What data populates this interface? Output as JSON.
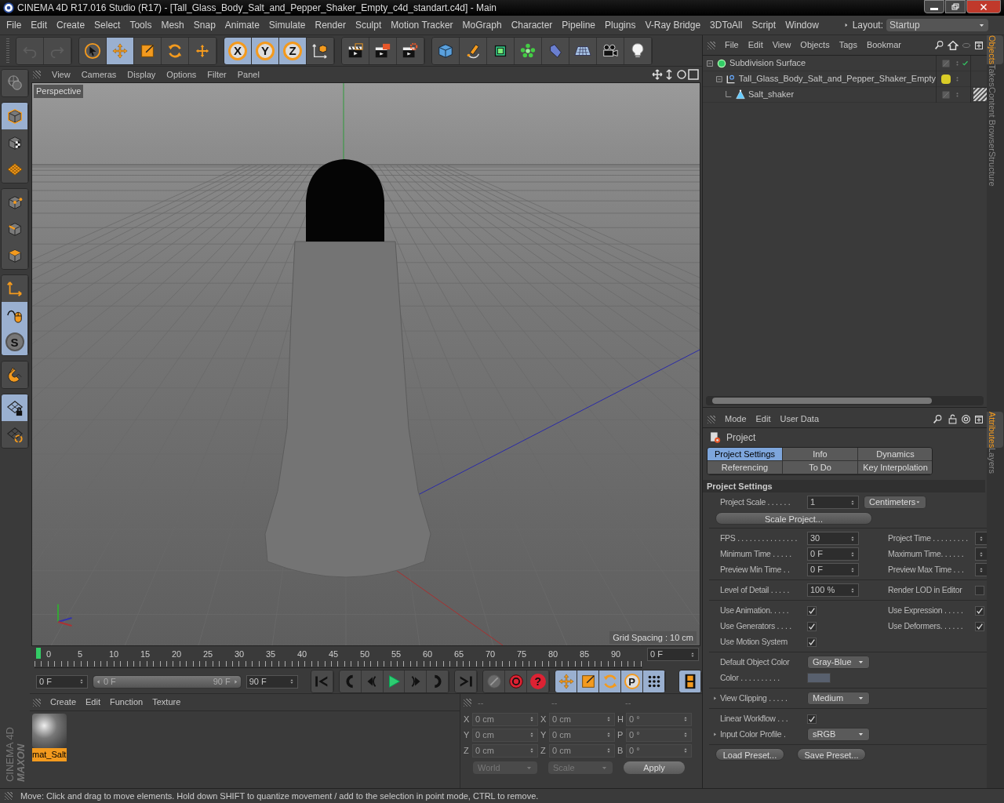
{
  "window": {
    "title": "CINEMA 4D R17.016 Studio (R17) - [Tall_Glass_Body_Salt_and_Pepper_Shaker_Empty_c4d_standart.c4d] - Main"
  },
  "menu": [
    "File",
    "Edit",
    "Create",
    "Select",
    "Tools",
    "Mesh",
    "Snap",
    "Animate",
    "Simulate",
    "Render",
    "Sculpt",
    "Motion Tracker",
    "MoGraph",
    "Character",
    "Pipeline",
    "Plugins",
    "V-Ray Bridge",
    "3DToAll",
    "Script",
    "Window"
  ],
  "layout": {
    "label": "Layout:",
    "value": "Startup"
  },
  "toolbar": [
    [
      {
        "kind": "undo",
        "selected": false
      },
      {
        "kind": "redo",
        "selected": false
      }
    ],
    [
      {
        "kind": "select",
        "selected": false
      },
      {
        "kind": "move",
        "selected": true
      },
      {
        "kind": "scale",
        "selected": false
      },
      {
        "kind": "rotate",
        "selected": false
      },
      {
        "kind": "transform",
        "selected": false
      }
    ],
    [
      {
        "kind": "axis",
        "label": "X",
        "selected": true
      },
      {
        "kind": "axis",
        "label": "Y",
        "selected": true
      },
      {
        "kind": "axis",
        "label": "Z",
        "selected": true
      },
      {
        "kind": "coords",
        "selected": false
      }
    ],
    [
      {
        "kind": "render-view",
        "selected": false
      },
      {
        "kind": "render-picture",
        "selected": false
      },
      {
        "kind": "render-settings",
        "selected": false
      }
    ],
    [
      {
        "kind": "cube",
        "selected": false
      },
      {
        "kind": "pen",
        "selected": false
      },
      {
        "kind": "subdivision",
        "selected": false
      },
      {
        "kind": "cloner",
        "selected": false
      },
      {
        "kind": "deformer",
        "selected": false
      },
      {
        "kind": "floor",
        "selected": false
      },
      {
        "kind": "camera",
        "selected": false
      },
      {
        "kind": "light",
        "selected": false
      }
    ]
  ],
  "left_tools": [
    [
      {
        "kind": "globe",
        "selected": false
      }
    ],
    [
      {
        "kind": "model",
        "selected": true
      },
      {
        "kind": "texture",
        "selected": false
      },
      {
        "kind": "workplane",
        "selected": false
      }
    ],
    [
      {
        "kind": "points",
        "selected": false
      },
      {
        "kind": "edges",
        "selected": false
      },
      {
        "kind": "polygons",
        "selected": false
      }
    ],
    [
      {
        "kind": "axis-mode",
        "selected": false
      },
      {
        "kind": "tweak",
        "selected": true
      },
      {
        "kind": "snap",
        "label": "S",
        "selected": true
      }
    ],
    [
      {
        "kind": "magnet",
        "selected": false
      }
    ],
    [
      {
        "kind": "grid-lock",
        "selected": true
      },
      {
        "kind": "grid-sync",
        "selected": false
      }
    ]
  ],
  "viewport": {
    "menu": [
      "View",
      "Cameras",
      "Display",
      "Options",
      "Filter",
      "Panel"
    ],
    "camera": "Perspective",
    "grid_spacing": "Grid Spacing : 10 cm"
  },
  "timeline": {
    "ticks": [
      "0",
      "5",
      "10",
      "15",
      "20",
      "25",
      "30",
      "35",
      "40",
      "45",
      "50",
      "55",
      "60",
      "65",
      "70",
      "75",
      "80",
      "85",
      "90"
    ],
    "current": "0 F"
  },
  "transport": {
    "start": "0 F",
    "range": {
      "start": "0 F",
      "end": "90 F",
      "level": 1
    },
    "end": "90 F",
    "buttons": [
      [
        {
          "kind": "first"
        }
      ],
      [
        {
          "kind": "prev-key"
        },
        {
          "kind": "prev-frame"
        },
        {
          "kind": "play"
        },
        {
          "kind": "next-frame"
        },
        {
          "kind": "next-key"
        }
      ],
      [
        {
          "kind": "last"
        }
      ],
      [
        {
          "kind": "record"
        },
        {
          "kind": "autokey"
        },
        {
          "kind": "help",
          "label": "?"
        }
      ],
      [
        {
          "kind": "move",
          "selected": true
        },
        {
          "kind": "scale",
          "selected": true
        },
        {
          "kind": "rotate",
          "selected": true
        },
        {
          "kind": "param",
          "label": "P",
          "selected": true
        },
        {
          "kind": "dots",
          "selected": true
        }
      ],
      [
        {
          "kind": "film",
          "selected": true
        }
      ]
    ]
  },
  "materials": {
    "menu": [
      "Create",
      "Edit",
      "Function",
      "Texture"
    ],
    "items": [
      {
        "name": "mat_Salt",
        "selected": true
      }
    ]
  },
  "coordinates": {
    "headers": [
      "--",
      "--",
      "--"
    ],
    "rows": [
      {
        "pos_axis": "X",
        "pos": "0 cm",
        "size_axis": "X",
        "size": "0 cm",
        "rot_axis": "H",
        "rot": "0 °"
      },
      {
        "pos_axis": "Y",
        "pos": "0 cm",
        "size_axis": "Y",
        "size": "0 cm",
        "rot_axis": "P",
        "rot": "0 °"
      },
      {
        "pos_axis": "Z",
        "pos": "0 cm",
        "size_axis": "Z",
        "size": "0 cm",
        "rot_axis": "B",
        "rot": "0 °"
      }
    ],
    "mode": "World",
    "measure": "Scale",
    "apply": "Apply"
  },
  "logo": {
    "brand": "MAXON",
    "product": "CINEMA 4D"
  },
  "status_bar": "Move: Click and drag to move elements. Hold down SHIFT to quantize movement / add to the selection in point mode, CTRL to remove.",
  "objects": {
    "menu": [
      "File",
      "Edit",
      "View",
      "Objects",
      "Tags",
      "Bookmar"
    ],
    "tree": [
      {
        "name": "Subdivision Surface",
        "kind": "subdivision",
        "checked": true,
        "children": [
          {
            "name": "Tall_Glass_Body_Salt_and_Pepper_Shaker_Empty",
            "kind": "null",
            "checked": false,
            "color": "#d9cc27",
            "children": [
              {
                "name": "Salt_shaker",
                "kind": "polygon",
                "checked": false,
                "material_tag": true
              }
            ]
          }
        ]
      }
    ]
  },
  "side_tabs_top": [
    {
      "label": "Objects",
      "selected": true
    },
    {
      "label": "Takes",
      "selected": false
    },
    {
      "label": "Content Browser",
      "selected": false
    },
    {
      "label": "Structure",
      "selected": false
    }
  ],
  "side_tabs_bottom": [
    {
      "label": "Attributes",
      "selected": true
    },
    {
      "label": "Layers",
      "selected": false
    }
  ],
  "attributes": {
    "menu": [
      "Mode",
      "Edit",
      "User Data"
    ],
    "title": "Project",
    "tabs": [
      {
        "label": "Project Settings",
        "selected": true
      },
      {
        "label": "Info",
        "selected": false
      },
      {
        "label": "Dynamics",
        "selected": false
      },
      {
        "label": "Referencing",
        "selected": false
      },
      {
        "label": "To Do",
        "selected": false
      },
      {
        "label": "Key Interpolation",
        "selected": false
      }
    ],
    "section": "Project Settings",
    "groups": [
      [
        {
          "left": {
            "kind": "number",
            "label": "Project Scale . . . . . .",
            "value": "1"
          },
          "right": {
            "kind": "dropdown",
            "value": "Centimeters"
          }
        },
        {
          "left": {
            "kind": "button",
            "label": "Scale Project..."
          }
        }
      ],
      [
        {
          "left": {
            "kind": "number",
            "label": "FPS . . . . . . . . . . . . . . .",
            "value": "30"
          },
          "right": {
            "kind": "number",
            "label": "Project Time . . . . . . . . ."
          }
        },
        {
          "left": {
            "kind": "number",
            "label": "Minimum Time . . . . .",
            "value": "0 F"
          },
          "right": {
            "kind": "number",
            "label": "Maximum Time. . . . . ."
          }
        },
        {
          "left": {
            "kind": "number",
            "label": "Preview Min Time . .",
            "value": "0 F"
          },
          "right": {
            "kind": "number",
            "label": "Preview Max Time . . ."
          }
        }
      ],
      [
        {
          "left": {
            "kind": "number",
            "label": "Level of Detail . . . . .",
            "value": "100 %"
          },
          "right": {
            "kind": "check",
            "label": "Render LOD in Editor",
            "checked": false
          }
        }
      ],
      [
        {
          "left": {
            "kind": "check",
            "label": "Use Animation. . . . .",
            "checked": true
          },
          "right": {
            "kind": "check",
            "label": "Use Expression . . . . .",
            "checked": true
          }
        },
        {
          "left": {
            "kind": "check",
            "label": "Use Generators . . . .",
            "checked": true
          },
          "right": {
            "kind": "check",
            "label": "Use Deformers. . . . . .",
            "checked": true
          }
        },
        {
          "left": {
            "kind": "check",
            "label": "Use Motion System",
            "checked": true
          }
        }
      ],
      [
        {
          "left": {
            "kind": "dropdown",
            "label": "Default Object Color",
            "value": "Gray-Blue"
          }
        },
        {
          "left": {
            "kind": "color",
            "label": "Color . . . . . . . . . .",
            "color": "#58606e"
          }
        }
      ],
      [
        {
          "left": {
            "kind": "dropdown",
            "label": "View Clipping . . . . .",
            "value": "Medium",
            "collapsed": true
          }
        }
      ],
      [
        {
          "left": {
            "kind": "check",
            "label": "Linear Workflow . . .",
            "checked": true
          }
        },
        {
          "left": {
            "kind": "dropdown",
            "label": "Input Color Profile .",
            "value": "sRGB",
            "collapsed": true
          }
        }
      ]
    ],
    "buttons": [
      "Load Preset...",
      "Save Preset..."
    ]
  }
}
